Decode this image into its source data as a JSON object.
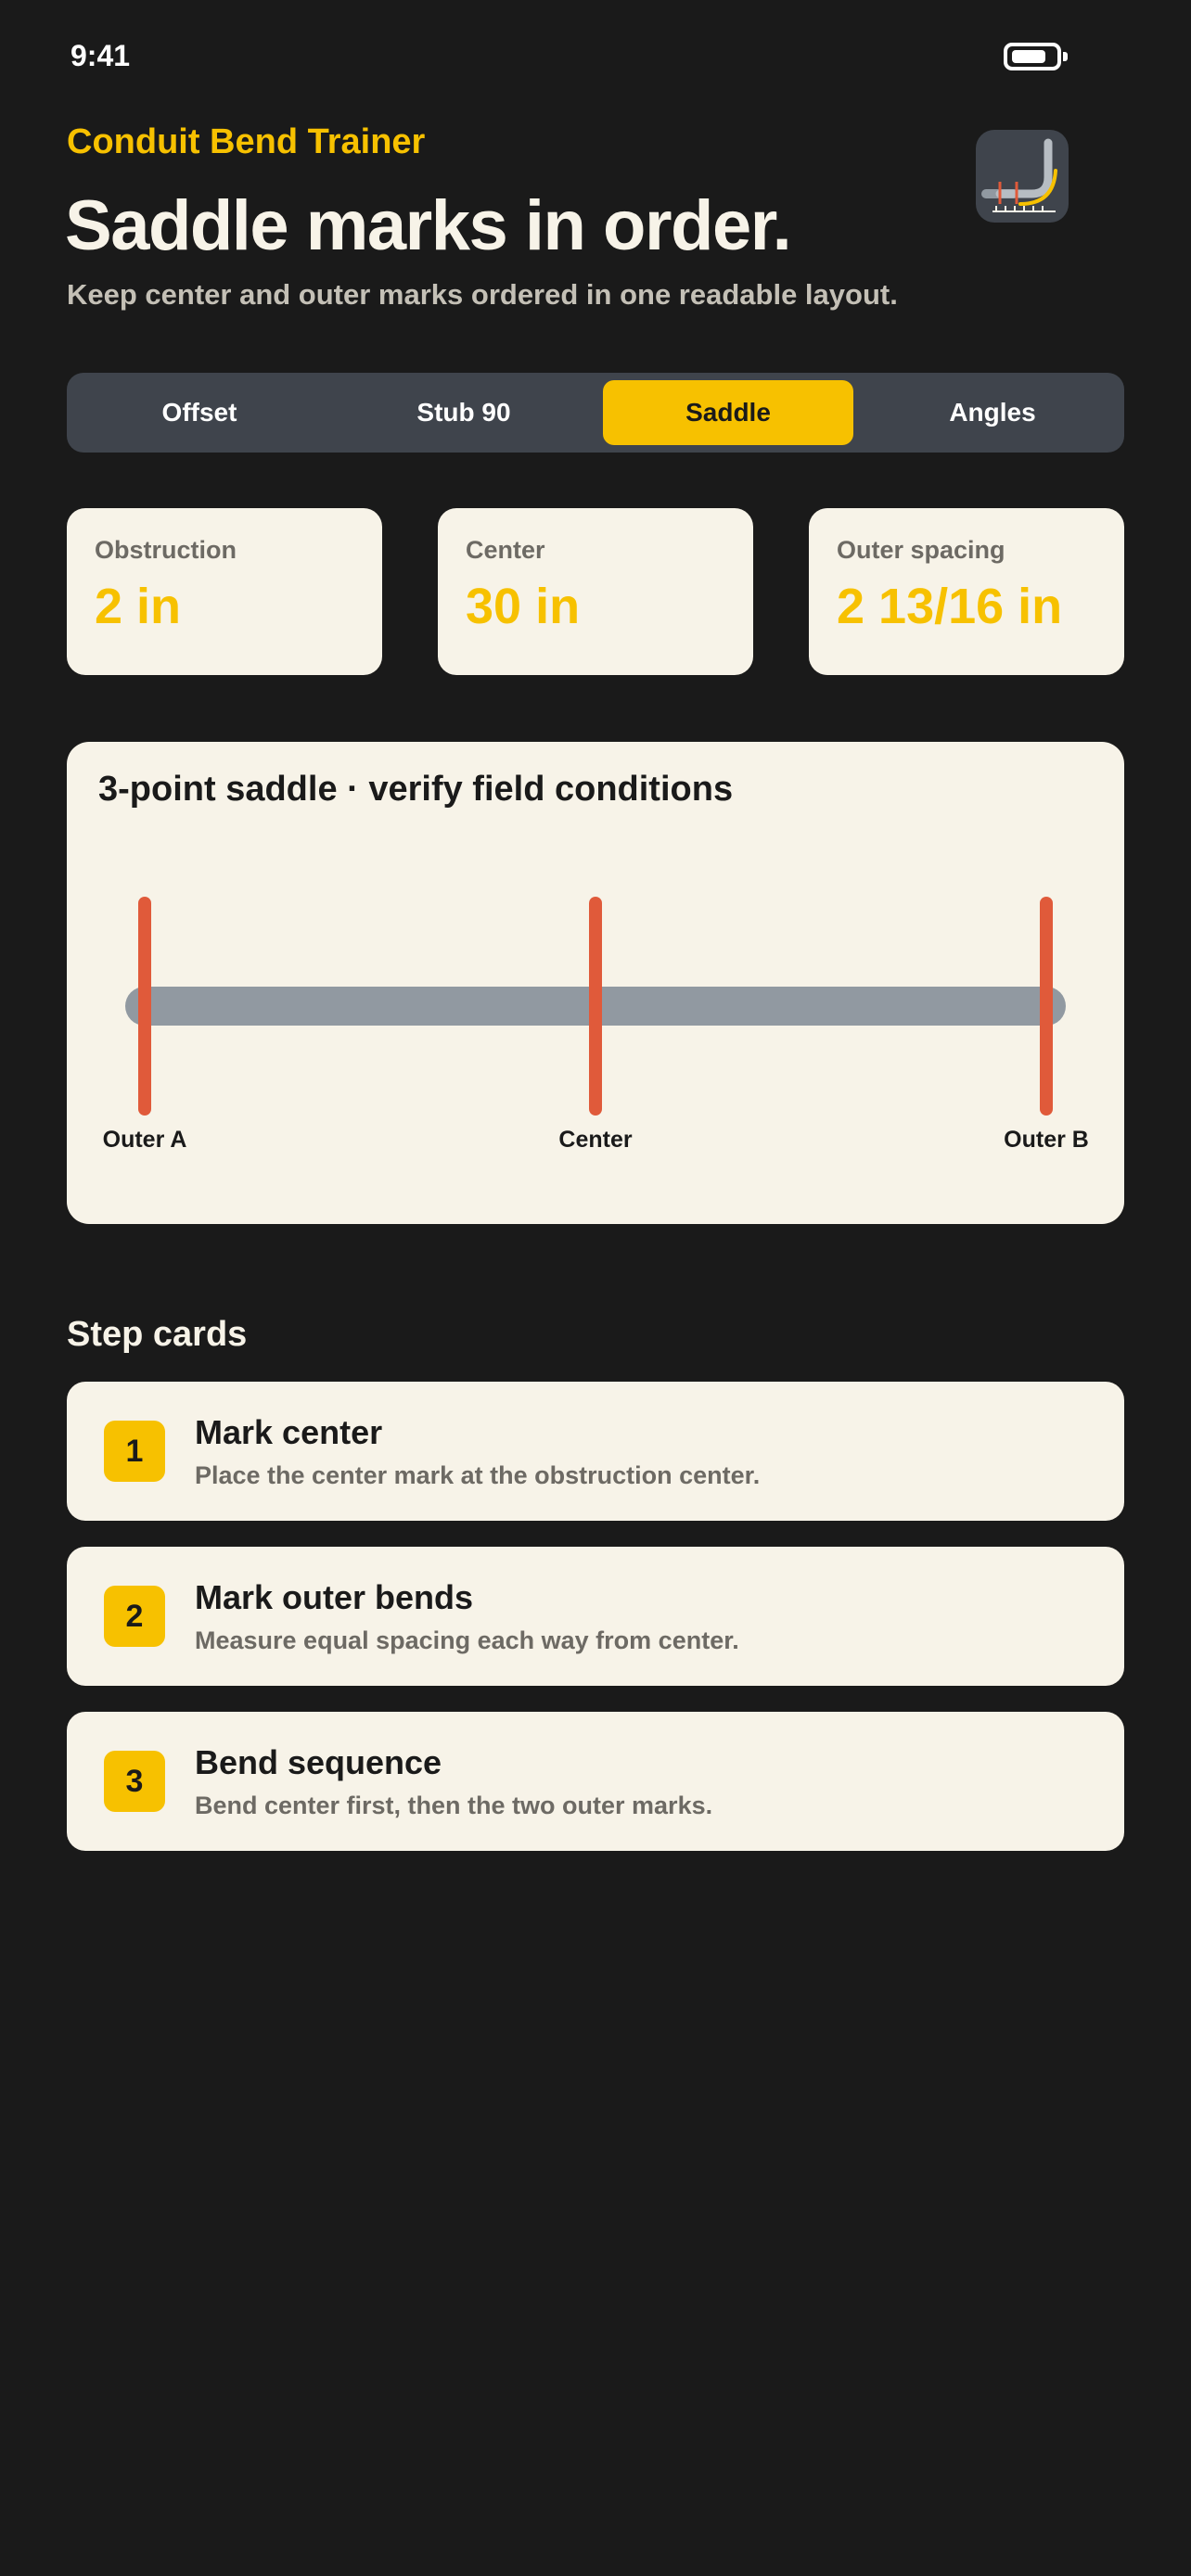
{
  "status_bar": {
    "time": "9:41",
    "battery_icon": "battery-icon"
  },
  "header": {
    "app_title": "Conduit Bend Trainer",
    "headline": "Saddle marks in order.",
    "subline": "Keep center and outer marks ordered in one readable layout.",
    "app_icon": "conduit-bend-app-icon"
  },
  "tabs": [
    {
      "label": "Offset",
      "active": false
    },
    {
      "label": "Stub 90",
      "active": false
    },
    {
      "label": "Saddle",
      "active": true
    },
    {
      "label": "Angles",
      "active": false
    }
  ],
  "stats": [
    {
      "label": "Obstruction",
      "value": "2 in"
    },
    {
      "label": "Center",
      "value": "30 in"
    },
    {
      "label": "Outer spacing",
      "value": "2 13/16 in"
    }
  ],
  "diagram": {
    "title": "3-point saddle · verify field conditions",
    "marks": [
      {
        "label": "Outer A"
      },
      {
        "label": "Center"
      },
      {
        "label": "Outer B"
      }
    ]
  },
  "steps": {
    "section_title": "Step cards",
    "items": [
      {
        "number": "1",
        "title": "Mark center",
        "description": "Place the center mark at the obstruction center."
      },
      {
        "number": "2",
        "title": "Mark outer bends",
        "description": "Measure equal spacing each way from center."
      },
      {
        "number": "3",
        "title": "Bend sequence",
        "description": "Bend center first, then the two outer marks."
      }
    ]
  },
  "colors": {
    "background": "#1a1a1a",
    "accent": "#f7c100",
    "card": "#f7f3e8",
    "mark": "#e05a3a",
    "conduit": "#9199a1",
    "tab_bar": "#3f444c"
  }
}
